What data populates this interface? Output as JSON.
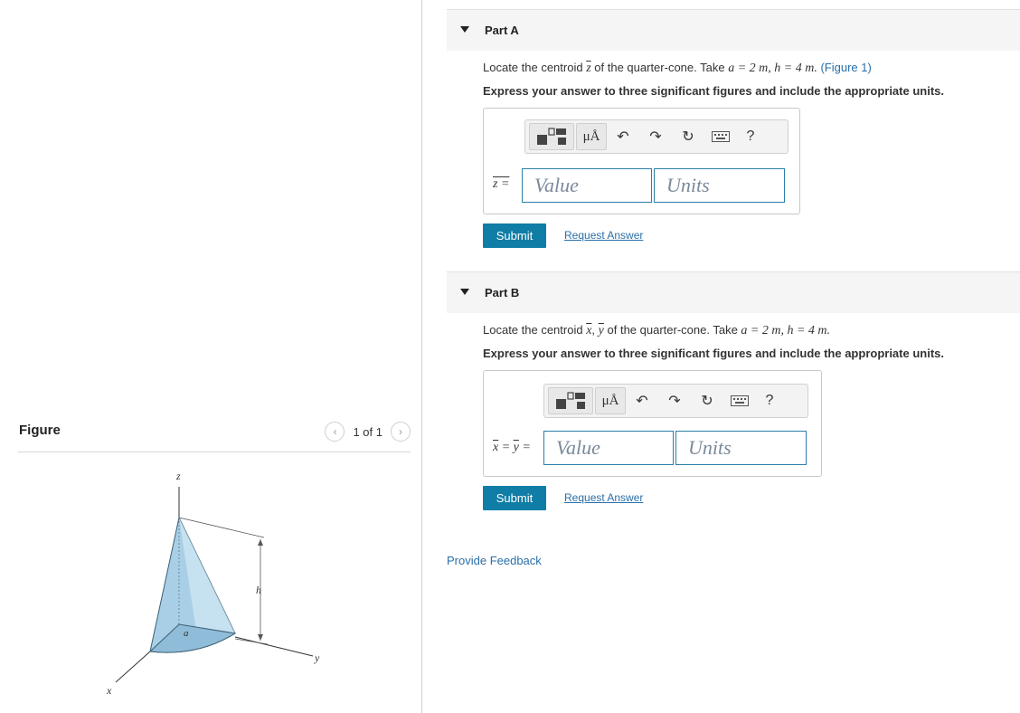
{
  "figure": {
    "title": "Figure",
    "pager_text": "1 of 1",
    "labels": {
      "z": "z",
      "h": "h",
      "a": "a",
      "x": "x",
      "y": "y"
    }
  },
  "part_a": {
    "title": "Part A",
    "prompt_prefix": "Locate the centroid",
    "prompt_var": "z",
    "prompt_mid": "of the quarter-cone. Take",
    "given": "a = 2 m, h = 4 m.",
    "figure_link": "(Figure 1)",
    "instruction": "Express your answer to three significant figures and include the appropriate units.",
    "eq_label": "z =",
    "value_placeholder": "Value",
    "units_placeholder": "Units",
    "submit": "Submit",
    "request": "Request Answer"
  },
  "part_b": {
    "title": "Part B",
    "prompt_prefix": "Locate the centroid",
    "prompt_var1": "x",
    "prompt_var2": "y",
    "prompt_mid": "of the quarter-cone. Take",
    "given": "a = 2 m, h = 4 m.",
    "instruction": "Express your answer to three significant figures and include the appropriate units.",
    "eq_label_x": "x",
    "eq_label_y": "y",
    "value_placeholder": "Value",
    "units_placeholder": "Units",
    "submit": "Submit",
    "request": "Request Answer"
  },
  "toolbar": {
    "units_label": "μÅ",
    "help_label": "?"
  },
  "feedback": "Provide Feedback",
  "colors": {
    "accent": "#0f7da5",
    "link": "#2a6fa8",
    "cone_fill": "#a9cfe6"
  }
}
